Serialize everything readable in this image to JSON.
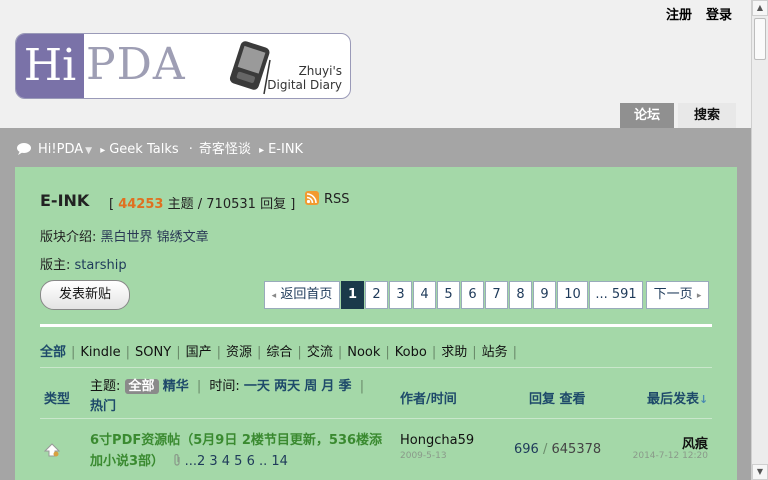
{
  "header": {
    "register": "注册",
    "login": "登录"
  },
  "logo": {
    "hi": "Hi",
    "pda": "PDA",
    "tagline_line1": "Zhuyi's",
    "tagline_line2": "Digital Diary"
  },
  "tabs": {
    "forum": "论坛",
    "search": "搜索"
  },
  "breadcrumb": {
    "home": "Hi!PDA",
    "cat1": "Geek Talks",
    "cat2": "奇客怪谈",
    "current": "E-INK",
    "dot": "·"
  },
  "forum": {
    "name": "E-INK",
    "bracket_open": "[",
    "threads": "44253",
    "threads_label": "主题",
    "slash": "/",
    "replies": "710531",
    "replies_label": "回复",
    "bracket_close": "]",
    "rss": "RSS",
    "desc_label": "版块介绍:",
    "desc_value": "黑白世界 锦绣文章",
    "mod_label": "版主:",
    "moderator": "starship"
  },
  "newpost_label": "发表新贴",
  "pagination": {
    "back": "返回首页",
    "pages": [
      "1",
      "2",
      "3",
      "4",
      "5",
      "6",
      "7",
      "8",
      "9",
      "10"
    ],
    "current": "1",
    "last": "... 591",
    "next": "下一页"
  },
  "filters": [
    "全部",
    "Kindle",
    "SONY",
    "国产",
    "资源",
    "综合",
    "交流",
    "Nook",
    "Kobo",
    "求助",
    "站务"
  ],
  "table_header": {
    "type": "类型",
    "topic_label": "主题:",
    "all": "全部",
    "digest": "精华",
    "time_label": "时间:",
    "t1": "一天",
    "t2": "两天",
    "t3": "周",
    "t4": "月",
    "t5": "季",
    "hot": "热门",
    "author": "作者/时间",
    "replies": "回复",
    "views": "查看",
    "lastpost": "最后发表",
    "sort_icon": "↓"
  },
  "threads": [
    {
      "title": "6寸PDF资源帖（5月9日 2楼节目更新，536楼添加小说3部）",
      "pages": "...2 3 4 5 6 .. 14",
      "author": "Hongcha59",
      "date": "2009-5-13",
      "replies": "696",
      "views": "645378",
      "lastposter": "风痕",
      "lastdate": "2014-7-12 12:20"
    }
  ],
  "colors": {
    "panel": "#a4d8a8",
    "band": "#a5a5a5",
    "accent_orange": "#e07020",
    "title_green": "#3a8a30",
    "link_blue": "#1e4a6a"
  },
  "icons": {
    "chat": "chat-bubble-icon",
    "rss": "rss-icon",
    "thread": "thread-up-icon",
    "attach": "attachment-icon"
  }
}
